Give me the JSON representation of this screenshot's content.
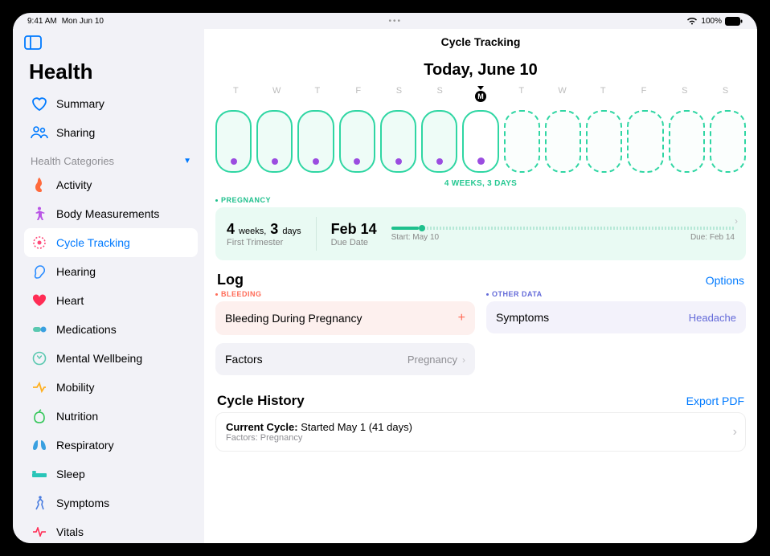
{
  "status": {
    "time": "9:41 AM",
    "date": "Mon Jun 10",
    "battery": "100%"
  },
  "app_title": "Health",
  "sidebar": {
    "summary": "Summary",
    "sharing": "Sharing",
    "categories_header": "Health Categories",
    "categories": [
      "Activity",
      "Body Measurements",
      "Cycle Tracking",
      "Hearing",
      "Heart",
      "Medications",
      "Mental Wellbeing",
      "Mobility",
      "Nutrition",
      "Respiratory",
      "Sleep",
      "Symptoms",
      "Vitals"
    ]
  },
  "main": {
    "title": "Cycle Tracking",
    "today_label": "Today, June 10",
    "weekdays": [
      "T",
      "W",
      "T",
      "F",
      "S",
      "S",
      "M",
      "T",
      "W",
      "T",
      "F",
      "S",
      "S"
    ],
    "today_index": 6,
    "today_letter": "M",
    "duration": "4 WEEKS, 3 DAYS",
    "pregnancy": {
      "tag": "PREGNANCY",
      "weeks": "4",
      "weeks_unit": "weeks,",
      "days": "3",
      "days_unit": "days",
      "sub1": "First Trimester",
      "due": "Feb 14",
      "due_sub": "Due Date",
      "start_label": "Start: May 10",
      "due_label": "Due: Feb 14"
    },
    "log": {
      "title": "Log",
      "options": "Options",
      "bleeding_tag": "BLEEDING",
      "other_tag": "OTHER DATA",
      "bleeding_label": "Bleeding During Pregnancy",
      "symptoms_label": "Symptoms",
      "symptoms_value": "Headache",
      "factors_label": "Factors",
      "factors_value": "Pregnancy"
    },
    "history": {
      "title": "Cycle History",
      "export": "Export PDF",
      "line1_label": "Current Cycle:",
      "line1_value": " Started May 1 (41 days)",
      "line2_label": "Factors:",
      "line2_value": " Pregnancy"
    }
  }
}
